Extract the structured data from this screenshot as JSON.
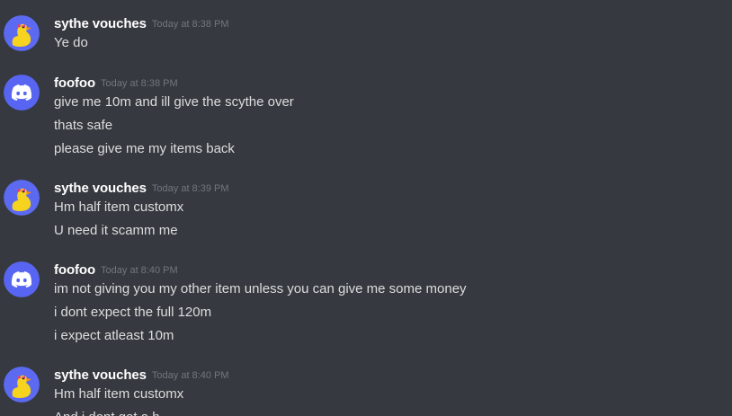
{
  "colors": {
    "background": "#36393f",
    "username": "#ffffff",
    "timestamp": "#72767d",
    "text": "#dcddde",
    "discord_blurple": "#5865f2",
    "duck_avatar_bg": "#5b6af0",
    "duck_yellow": "#f6d31f",
    "duck_beak": "#f58a1e",
    "duck_bow": "#e0407a"
  },
  "icons": {
    "duck_avatar": "duck-avatar-icon",
    "discord_avatar": "discord-logo-icon"
  },
  "messages": [
    {
      "author": "sythe vouches",
      "avatar": "duck",
      "timestamp": "Today at 8:38 PM",
      "lines": [
        "Ye do"
      ]
    },
    {
      "author": "foofoo",
      "avatar": "discord",
      "timestamp": "Today at 8:38 PM",
      "lines": [
        "give me 10m and ill give the scythe over",
        "thats safe",
        "please give me my items back"
      ]
    },
    {
      "author": "sythe vouches",
      "avatar": "duck",
      "timestamp": "Today at 8:39 PM",
      "lines": [
        "Hm half item customx",
        "U need it scamm me"
      ]
    },
    {
      "author": "foofoo",
      "avatar": "discord",
      "timestamp": "Today at 8:40 PM",
      "lines": [
        "im not giving you my other item unless you can give me some money",
        "i dont expect the full 120m",
        "i expect atleast 10m"
      ]
    },
    {
      "author": "sythe vouches",
      "avatar": "duck",
      "timestamp": "Today at 8:40 PM",
      "lines": [
        "Hm half item customx",
        "And i dont get a h"
      ]
    }
  ]
}
